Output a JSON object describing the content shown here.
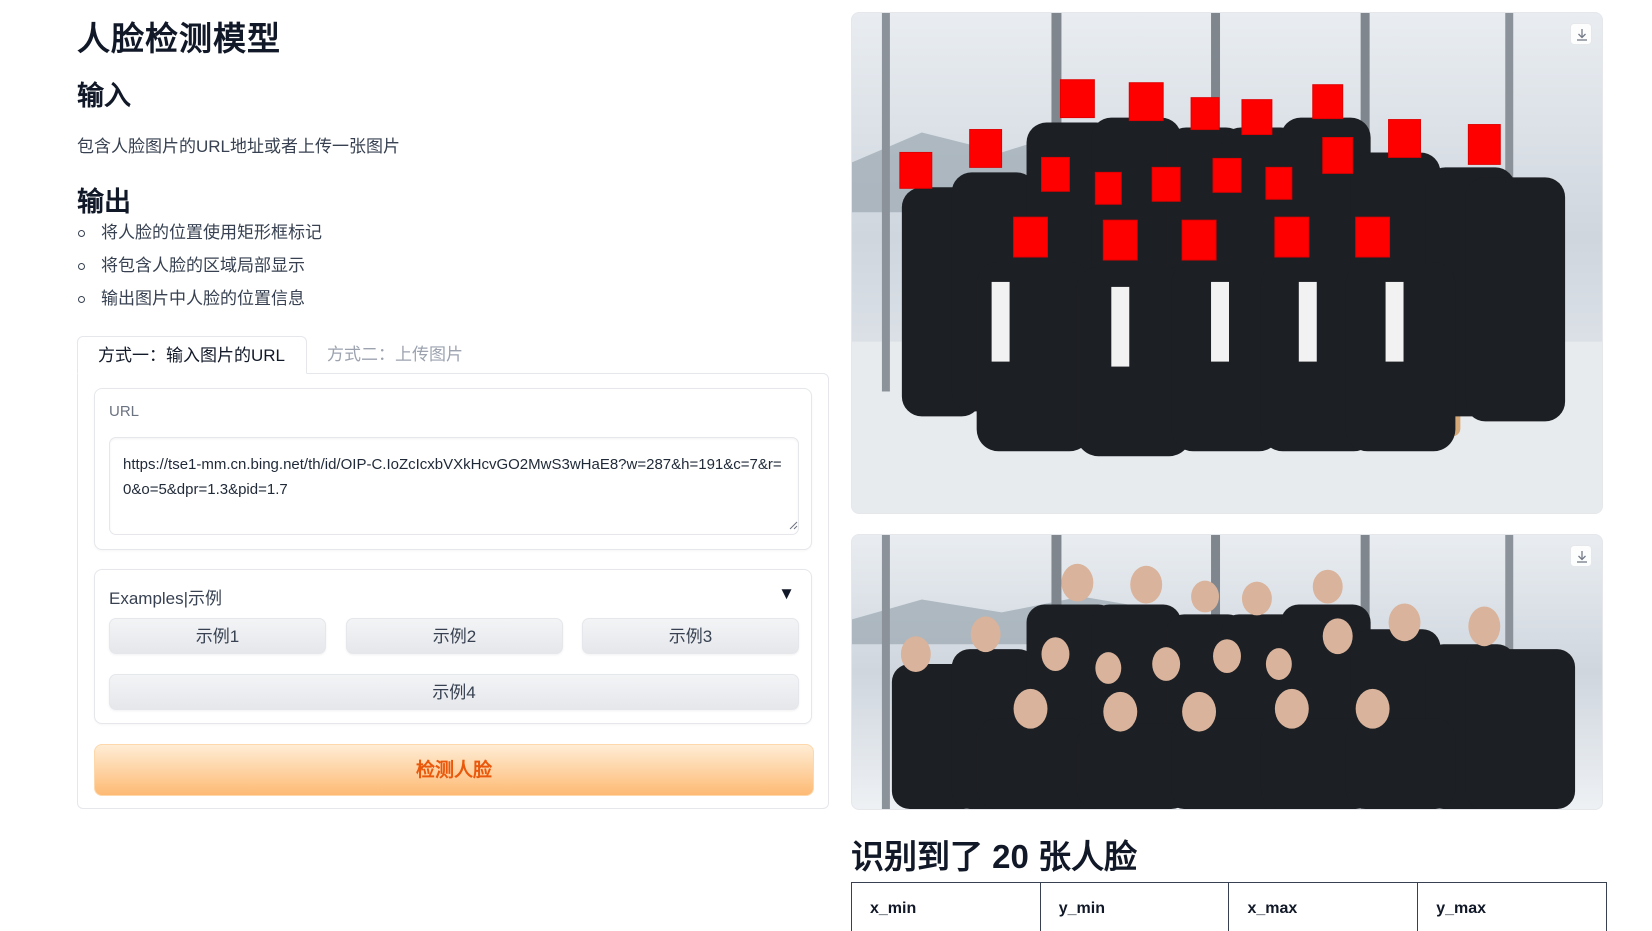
{
  "app": {
    "title": "人脸检测模型",
    "input_heading": "输入",
    "input_description": "包含人脸图片的URL地址或者上传一张图片",
    "output_heading": "输出",
    "output_items": [
      "将人脸的位置使用矩形框标记",
      "将包含人脸的区域局部显示",
      "输出图片中人脸的位置信息"
    ]
  },
  "tabs": [
    {
      "label": "方式一：输入图片的URL",
      "active": true
    },
    {
      "label": "方式二：上传图片",
      "active": false
    }
  ],
  "url_field": {
    "label": "URL",
    "value": "https://tse1-mm.cn.bing.net/th/id/OIP-C.IoZcIcxbVXkHcvGO2MwS3wHaE8?w=287&h=191&c=7&r=0&o=5&dpr=1.3&pid=1.7"
  },
  "examples": {
    "label": "Examples|示例",
    "caret": "▼",
    "buttons": [
      "示例1",
      "示例2",
      "示例3",
      "示例4"
    ]
  },
  "detect_button": {
    "label": "检测人脸",
    "color": "#ea580c"
  },
  "images": {
    "annotated": {
      "download_icon": "download-icon",
      "box_color": "#ff0000"
    },
    "original": {
      "download_icon": "download-icon"
    }
  },
  "result": {
    "title": "识别到了 20 张人脸",
    "columns": [
      "x_min",
      "y_min",
      "x_max",
      "y_max"
    ]
  },
  "colors": {
    "accent": "#f97316",
    "border": "#e5e7eb",
    "text": "#1f2937"
  }
}
